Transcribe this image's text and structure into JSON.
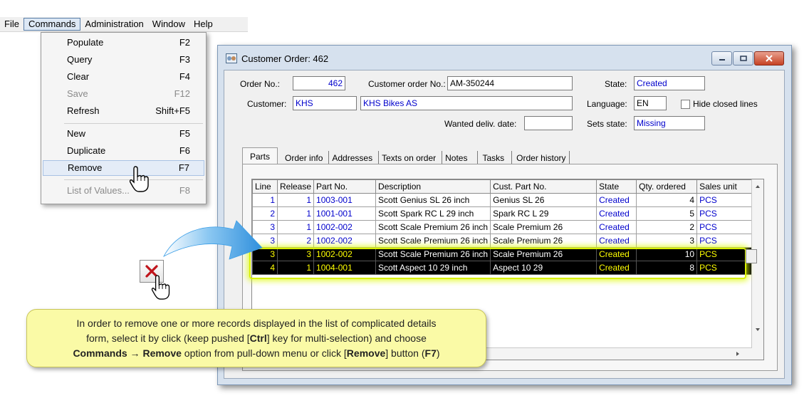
{
  "menubar": {
    "items": [
      "File",
      "Commands",
      "Administration",
      "Window",
      "Help"
    ]
  },
  "commands_menu": {
    "items": [
      {
        "label": "Populate",
        "key": "F2"
      },
      {
        "label": "Query",
        "key": "F3"
      },
      {
        "label": "Clear",
        "key": "F4"
      },
      {
        "label": "Save",
        "key": "F12"
      },
      {
        "label": "Refresh",
        "key": "Shift+F5"
      },
      {
        "label": "New",
        "key": "F5"
      },
      {
        "label": "Duplicate",
        "key": "F6"
      },
      {
        "label": "Remove",
        "key": "F7"
      },
      {
        "label": "List of Values...",
        "key": "F8"
      }
    ]
  },
  "window": {
    "title": "Customer Order: 462"
  },
  "header": {
    "order_no_label": "Order No.:",
    "order_no": "462",
    "customer_order_no_label": "Customer order No.:",
    "customer_order_no": "AM-350244",
    "state_label": "State:",
    "state": "Created",
    "customer_label": "Customer:",
    "customer_id": "KHS",
    "customer_name": "KHS Bikes AS",
    "language_label": "Language:",
    "language": "EN",
    "hide_closed_label": "Hide closed lines",
    "wanted_date_label": "Wanted deliv. date:",
    "wanted_date": "",
    "sets_state_label": "Sets state:",
    "sets_state": "Missing"
  },
  "tabs": [
    "Parts",
    "Order info",
    "Addresses",
    "Texts on order",
    "Notes",
    "Tasks",
    "Order history"
  ],
  "grid": {
    "columns": [
      "Line",
      "Release",
      "Part No.",
      "Description",
      "Cust. Part No.",
      "State",
      "Qty. ordered",
      "Sales unit"
    ],
    "rows": [
      {
        "line": "1",
        "release": "1",
        "part": "1003-001",
        "desc": "Scott Genius SL 26 inch",
        "cust": "Genius SL 26",
        "state": "Created",
        "qty": "4",
        "unit": "PCS",
        "selected": false
      },
      {
        "line": "2",
        "release": "1",
        "part": "1001-001",
        "desc": "Scott Spark RC L 29 inch",
        "cust": "Spark RC L 29",
        "state": "Created",
        "qty": "5",
        "unit": "PCS",
        "selected": false
      },
      {
        "line": "3",
        "release": "1",
        "part": "1002-002",
        "desc": "Scott Scale Premium 26 inch",
        "cust": "Scale Premium 26",
        "state": "Created",
        "qty": "2",
        "unit": "PCS",
        "selected": false
      },
      {
        "line": "3",
        "release": "2",
        "part": "1002-002",
        "desc": "Scott Scale Premium 26 inch",
        "cust": "Scale Premium 26",
        "state": "Created",
        "qty": "3",
        "unit": "PCS",
        "selected": false
      },
      {
        "line": "3",
        "release": "3",
        "part": "1002-002",
        "desc": "Scott Scale Premium 26 inch",
        "cust": "Scale Premium 26",
        "state": "Created",
        "qty": "10",
        "unit": "PCS",
        "selected": true
      },
      {
        "line": "4",
        "release": "1",
        "part": "1004-001",
        "desc": "Scott Aspect 10 29 inch",
        "cust": "Aspect 10 29",
        "state": "Created",
        "qty": "8",
        "unit": "PCS",
        "selected": true
      }
    ]
  },
  "callout": {
    "line1": "In order to remove one or more records displayed in the list of complicated details",
    "line2a": "form, select it by click (keep pushed [",
    "line2b": "Ctrl",
    "line2c": "] key for multi-selection) and choose",
    "line3a": "Commands",
    "line3b": " → ",
    "line3c": "Remove",
    "line3d": " option from pull-down menu or click [",
    "line3e": "Remove",
    "line3f": "] button (",
    "line3g": "F7",
    "line3h": ")"
  },
  "colors": {
    "link_blue": "#0000cc",
    "selection_bg": "#000000",
    "selection_text": "#ffff00",
    "highlight_glow": "#d8f000",
    "callout_bg": "#fafaa6",
    "arrow_blue": "#3b9ee6"
  },
  "icons": [
    "customer-order-window-icon",
    "remove-record-icon",
    "pointing-hand-icon",
    "curved-arrow-icon"
  ]
}
